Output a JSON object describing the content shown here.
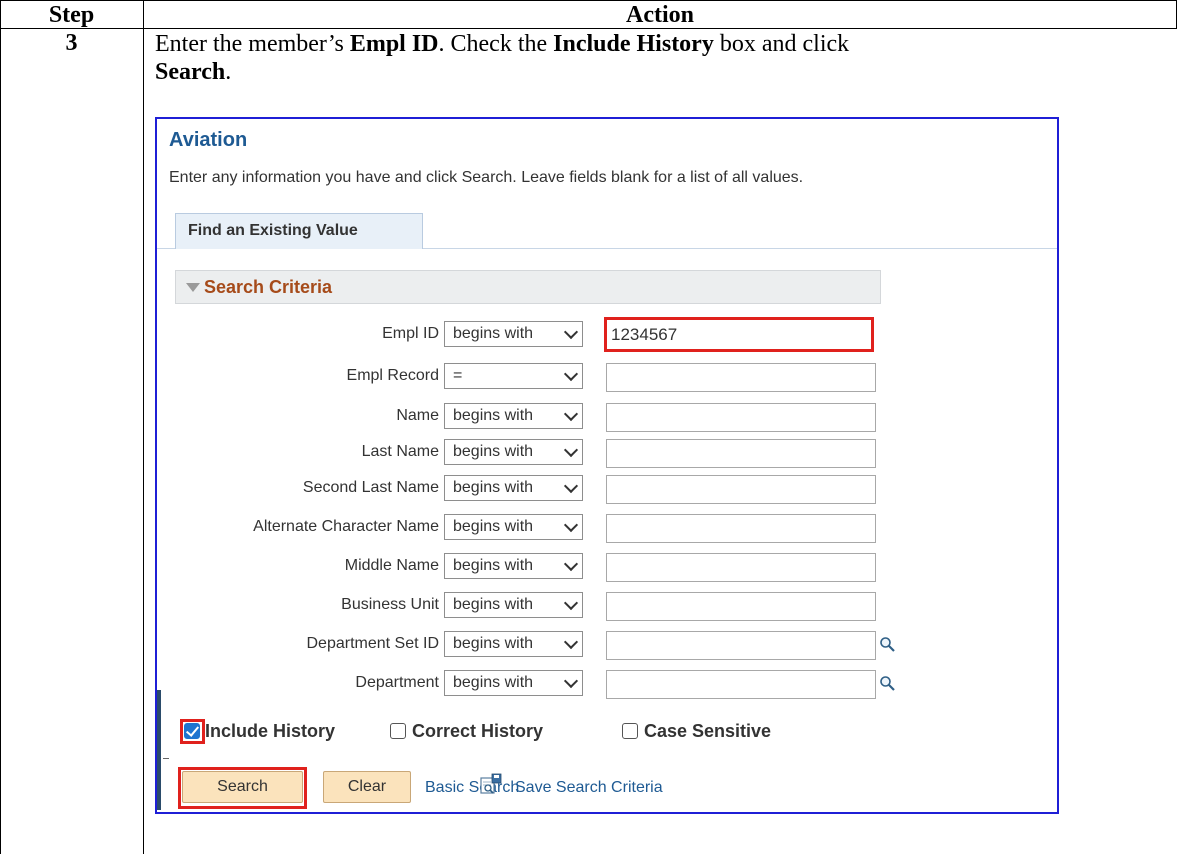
{
  "table": {
    "col_step": "Step",
    "col_action": "Action",
    "step_number": "3",
    "instruction_parts": [
      "Enter the member’s ",
      "Empl ID",
      ". Check the ",
      "Include History",
      " box and click ",
      "Search",
      "."
    ]
  },
  "screen": {
    "title": "Aviation",
    "instructions": "Enter any information you have and click Search. Leave fields blank for a list of all values.",
    "tab": "Find an Existing Value",
    "section": "Search Criteria",
    "fields": [
      {
        "label": "Empl ID",
        "operator": "begins with",
        "value": "1234567"
      },
      {
        "label": "Empl Record",
        "operator": "=",
        "value": ""
      },
      {
        "label": "Name",
        "operator": "begins with",
        "value": ""
      },
      {
        "label": "Last Name",
        "operator": "begins with",
        "value": ""
      },
      {
        "label": "Second Last Name",
        "operator": "begins with",
        "value": ""
      },
      {
        "label": "Alternate Character Name",
        "operator": "begins with",
        "value": ""
      },
      {
        "label": "Middle Name",
        "operator": "begins with",
        "value": ""
      },
      {
        "label": "Business Unit",
        "operator": "begins with",
        "value": ""
      },
      {
        "label": "Department Set ID",
        "operator": "begins with",
        "value": ""
      },
      {
        "label": "Department",
        "operator": "begins with",
        "value": ""
      }
    ],
    "checkboxes": [
      {
        "label": "Include History",
        "checked": true
      },
      {
        "label": "Correct History",
        "checked": false
      },
      {
        "label": "Case Sensitive",
        "checked": false
      }
    ],
    "buttons": {
      "search": "Search",
      "clear": "Clear",
      "basic_search": "Basic Search",
      "save_search": "Save Search Criteria"
    },
    "icons": {
      "lookup": "magnifier-icon",
      "save": "save-search-icon"
    },
    "colors": {
      "highlight": "#e0211d",
      "frame": "#1f1fd6",
      "title": "#1e5a93",
      "section_label": "#a64b1a"
    }
  }
}
